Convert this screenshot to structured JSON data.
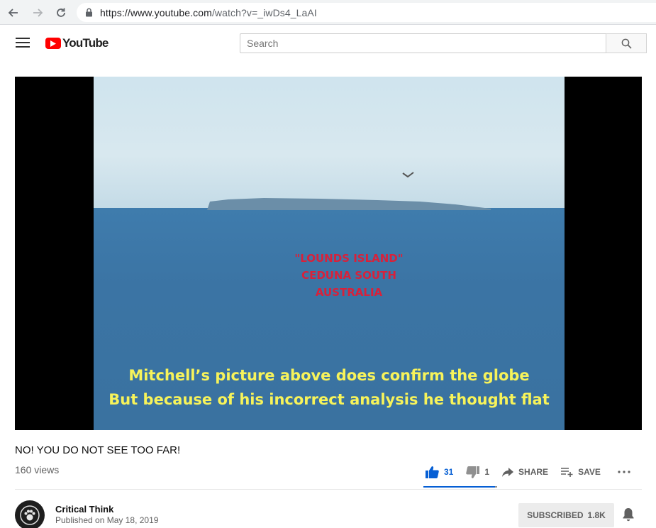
{
  "browser": {
    "url_host": "https://www.youtube.com",
    "url_path": "/watch?v=_iwDs4_LaAI"
  },
  "header": {
    "logo_text": "YouTube",
    "search_placeholder": "Search"
  },
  "video": {
    "overlay_red_lines": [
      "\"LOUNDS ISLAND\"",
      "CEDUNA SOUTH",
      "AUSTRALIA"
    ],
    "overlay_yellow_lines": [
      "Mitchell’s picture above does confirm the globe",
      "But because of his incorrect analysis he thought flat"
    ],
    "title": "NO! YOU DO NOT SEE TOO FAR!",
    "views": "160 views",
    "likes": "31",
    "dislikes": "1",
    "like_ratio_percent": 97,
    "share_label": "SHARE",
    "save_label": "SAVE"
  },
  "channel": {
    "name": "Critical Think",
    "published": "Published on May 18, 2019",
    "subscribe_label": "SUBSCRIBED",
    "subscriber_count": "1.8K"
  },
  "colors": {
    "youtube_red": "#ff0000",
    "like_blue": "#065fd4",
    "overlay_red": "#d8213a",
    "overlay_yellow": "#f7f35a"
  }
}
